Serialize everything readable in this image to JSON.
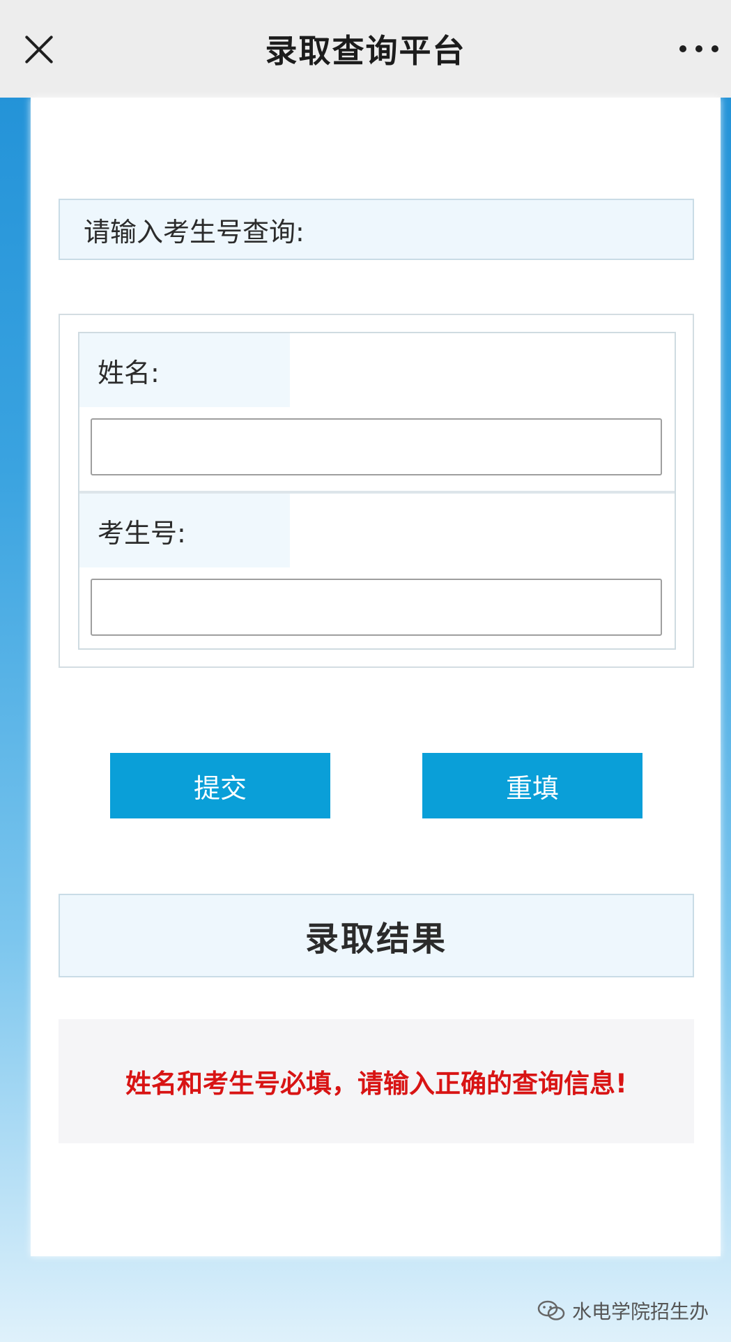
{
  "header": {
    "title": "录取查询平台",
    "close_icon": "close-icon",
    "more_icon": "more-icon"
  },
  "form": {
    "prompt": "请输入考生号查询:",
    "name_label": "姓名:",
    "name_value": "",
    "exam_id_label": "考生号:",
    "exam_id_value": ""
  },
  "buttons": {
    "submit_label": "提交",
    "reset_label": "重填"
  },
  "result": {
    "title": "录取结果",
    "message": "姓名和考生号必填，请输入正确的查询信息!"
  },
  "watermark": {
    "icon": "wechat-icon",
    "text": "水电学院招生办"
  },
  "colors": {
    "button": "#0a9fd8",
    "error_text": "#d81414",
    "label_background": "#f0f8fd"
  }
}
